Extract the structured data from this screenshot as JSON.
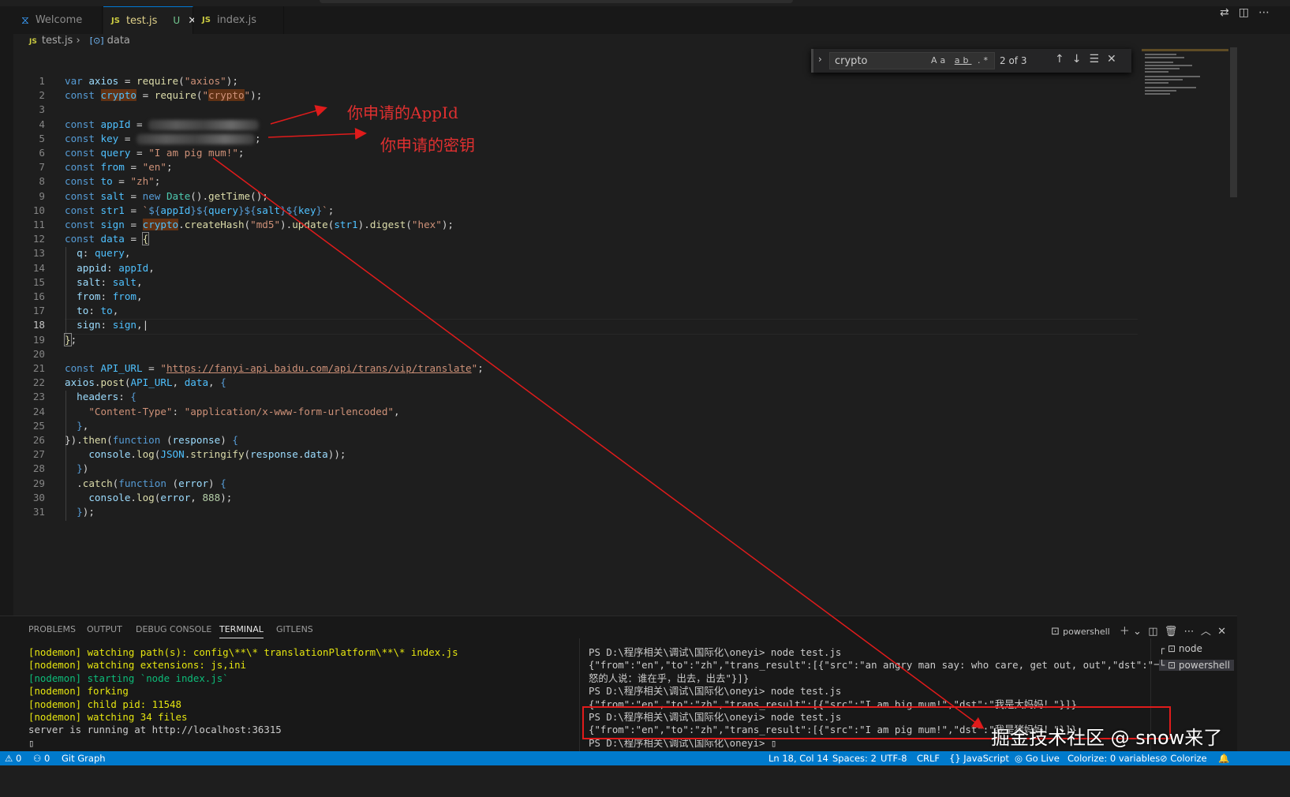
{
  "tabs": [
    {
      "icon": "vscode-icon",
      "label": "Welcome"
    },
    {
      "icon": "JS",
      "label": "test.js",
      "status": "U",
      "close": "✕"
    },
    {
      "icon": "JS",
      "label": "index.js"
    }
  ],
  "breadcrumb": {
    "file": "test.js",
    "symbol": "data"
  },
  "find": {
    "query": "crypto",
    "count": "2 of 3",
    "opt_case": "Aa",
    "opt_word": "ab",
    "opt_regex": ".*"
  },
  "annotations": {
    "appid": "你申请的AppId",
    "key": "你申请的密钥"
  },
  "panel": {
    "tabs": [
      "PROBLEMS",
      "OUTPUT",
      "DEBUG CONSOLE",
      "TERMINAL",
      "GITLENS"
    ],
    "shell": "powershell",
    "terminals": [
      "node",
      "powershell"
    ]
  },
  "terminal_left": [
    {
      "c": "y",
      "t": "[nodemon] watching path(s): config\\**\\* translationPlatform\\**\\* index.js"
    },
    {
      "c": "y",
      "t": "[nodemon] watching extensions: js,ini"
    },
    {
      "c": "g",
      "t": "[nodemon] starting `node index.js`"
    },
    {
      "c": "y",
      "t": "[nodemon] forking"
    },
    {
      "c": "y",
      "t": "[nodemon] child pid: 11548"
    },
    {
      "c": "y",
      "t": "[nodemon] watching 34 files"
    },
    {
      "c": "w",
      "t": "server is running at http://localhost:36315"
    },
    {
      "c": "w",
      "t": "▯"
    }
  ],
  "terminal_right": [
    "PS D:\\程序相关\\调试\\国际化\\oneyi> node test.js",
    "{\"from\":\"en\",\"to\":\"zh\",\"trans_result\":[{\"src\":\"an angry man say: who care, get out, out\",\"dst\":\"一个愤",
    "怒的人说：谁在乎，出去，出去\"}]}",
    "PS D:\\程序相关\\调试\\国际化\\oneyi> node test.js",
    "{\"from\":\"en\",\"to\":\"zh\",\"trans_result\":[{\"src\":\"I am big mum!\",\"dst\":\"我是大妈妈！\"}]}",
    "PS D:\\程序相关\\调试\\国际化\\oneyi> node test.js",
    "{\"from\":\"en\",\"to\":\"zh\",\"trans_result\":[{\"src\":\"I am pig mum!\",\"dst\":\"我是猪妈妈！\"}]}",
    "PS D:\\程序相关\\调试\\国际化\\oneyi> ▯"
  ],
  "watermark": "掘金技术社区 @ snow来了",
  "status": {
    "errors": "⚠ 0",
    "ports": "⚇ 0",
    "git": "Git Graph",
    "position": "Ln 18, Col 14",
    "spaces": "Spaces: 2",
    "encoding": "UTF-8",
    "eol": "CRLF",
    "language": "{} JavaScript",
    "golive": "◎ Go Live",
    "colorize": "Colorize: 0 variables",
    "colorize2": "⊘ Colorize",
    "bell": "🔔"
  },
  "code": [
    {
      "n": "1",
      "h": "<span class='kw'>var</span> <span class='var'>axios</span> = <span class='fn'>require</span>(<span class='str'>\"axios\"</span>);"
    },
    {
      "n": "2",
      "h": "<span class='kw'>const</span> <span class='const hl'>crypto</span> = <span class='fn'>require</span>(<span class='str'>\"<span class='hl'>crypto</span>\"</span>);"
    },
    {
      "n": "3",
      "h": ""
    },
    {
      "n": "4",
      "h": "<span class='kw'>const</span> <span class='const'>appId</span> = <span class='blur' style='width:140px'></span>"
    },
    {
      "n": "5",
      "h": "<span class='kw'>const</span> <span class='const'>key</span> = <span class='blur' style='width:150px'></span>;"
    },
    {
      "n": "6",
      "h": "<span class='kw'>const</span> <span class='const'>query</span> = <span class='str'>\"I am pig mum!\"</span>;"
    },
    {
      "n": "7",
      "h": "<span class='kw'>const</span> <span class='const'>from</span> = <span class='str'>\"en\"</span>;"
    },
    {
      "n": "8",
      "h": "<span class='kw'>const</span> <span class='const'>to</span> = <span class='str'>\"zh\"</span>;"
    },
    {
      "n": "9",
      "h": "<span class='kw'>const</span> <span class='const'>salt</span> = <span class='kw'>new</span> <span class='cls'>Date</span>().<span class='fn'>getTime</span>();"
    },
    {
      "n": "10",
      "h": "<span class='kw'>const</span> <span class='const'>str1</span> = <span class='str'>`</span><span class='kw'>${</span><span class='const'>appId</span><span class='kw'>}${</span><span class='const'>query</span><span class='kw'>}${</span><span class='const'>salt</span><span class='kw'>}${</span><span class='const'>key</span><span class='kw'>}</span><span class='str'>`</span>;"
    },
    {
      "n": "11",
      "h": "<span class='kw'>const</span> <span class='const'>sign</span> = <span class='const hl'>crypto</span>.<span class='fn'>createHash</span>(<span class='str'>\"md5\"</span>).<span class='fn'>update</span>(<span class='const'>str1</span>).<span class='fn'>digest</span>(<span class='str'>\"hex\"</span>);"
    },
    {
      "n": "12",
      "h": "<span class='kw'>const</span> <span class='const'>data</span> = <span class='fn bracket'>{</span>"
    },
    {
      "n": "13",
      "h": "  <span class='var'>q</span>: <span class='const'>query</span>,"
    },
    {
      "n": "14",
      "h": "  <span class='var'>appid</span>: <span class='const'>appId</span>,"
    },
    {
      "n": "15",
      "h": "  <span class='var'>salt</span>: <span class='const'>salt</span>,"
    },
    {
      "n": "16",
      "h": "  <span class='var'>from</span>: <span class='const'>from</span>,"
    },
    {
      "n": "17",
      "h": "  <span class='var'>to</span>: <span class='const'>to</span>,"
    },
    {
      "n": "18",
      "h": "  <span class='var'>sign</span>: <span class='const'>sign</span>,|"
    },
    {
      "n": "19",
      "h": "<span class='fn bracket'>}</span>;"
    },
    {
      "n": "20",
      "h": ""
    },
    {
      "n": "21",
      "h": "<span class='kw'>const</span> <span class='const'>API_URL</span> = <span class='str'>\"</span><span class='url'>https://fanyi-api.baidu.com/api/trans/vip/translate</span><span class='str'>\"</span>;"
    },
    {
      "n": "22",
      "h": "<span class='var'>axios</span>.<span class='fn'>post</span>(<span class='const'>API_URL</span>, <span class='const'>data</span>, <span class='kw'>{</span>"
    },
    {
      "n": "23",
      "h": "  <span class='var'>headers</span>: <span class='kw'>{</span>"
    },
    {
      "n": "24",
      "h": "    <span class='str'>\"Content-Type\"</span>: <span class='str'>\"application/x-www-form-urlencoded\"</span>,"
    },
    {
      "n": "25",
      "h": "  <span class='kw'>}</span>,"
    },
    {
      "n": "26",
      "h": "}).<span class='fn'>then</span>(<span class='kw'>function</span> (<span class='var'>response</span>) <span class='kw'>{</span>"
    },
    {
      "n": "27",
      "h": "    <span class='var'>console</span>.<span class='fn'>log</span>(<span class='const'>JSON</span>.<span class='fn'>stringify</span>(<span class='var'>response</span>.<span class='var'>data</span>));"
    },
    {
      "n": "28",
      "h": "  <span class='kw'>}</span>)"
    },
    {
      "n": "29",
      "h": "  .<span class='fn'>catch</span>(<span class='kw'>function</span> (<span class='var'>error</span>) <span class='kw'>{</span>"
    },
    {
      "n": "30",
      "h": "    <span class='var'>console</span>.<span class='fn'>log</span>(<span class='var'>error</span>, <span class='num'>888</span>);"
    },
    {
      "n": "31",
      "h": "  <span class='kw'>}</span>);"
    }
  ]
}
